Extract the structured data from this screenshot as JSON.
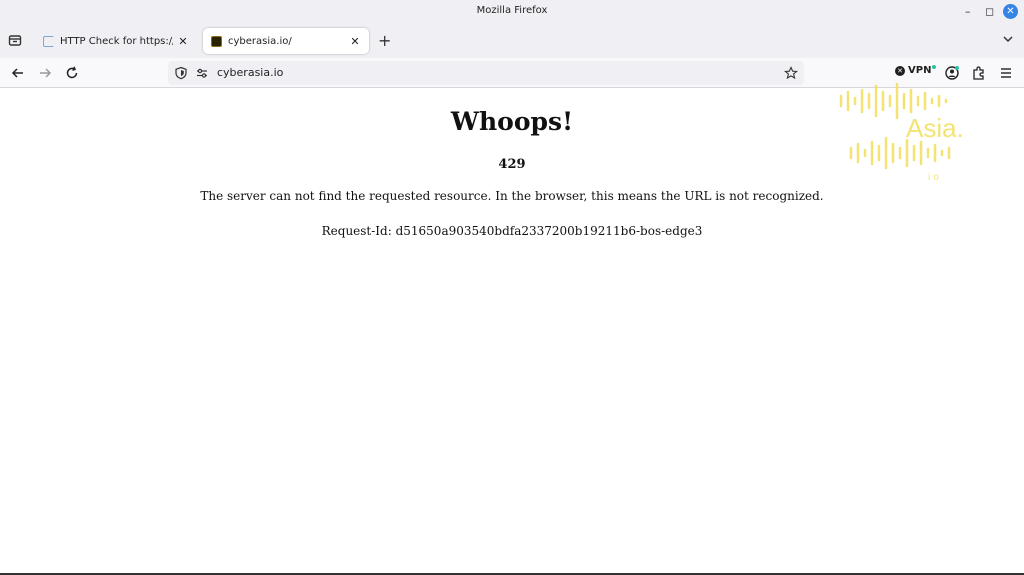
{
  "window": {
    "title": "Mozilla Firefox",
    "controls": {
      "minimize": "–",
      "maximize": "◻",
      "close": "✕"
    }
  },
  "tabs": [
    {
      "label": "HTTP Check for https://cybe",
      "close": "✕",
      "active": false
    },
    {
      "label": "cyberasia.io/",
      "close": "✕",
      "active": true
    }
  ],
  "new_tab": "+",
  "url": "cyberasia.io",
  "vpn_label": "VPN",
  "page": {
    "heading": "Whoops!",
    "code": "429",
    "message": "The server can not find the requested resource. In the browser, this means the URL is not recognized.",
    "request_id": "Request-Id: d51650a903540bdfa2337200b19211b6-bos-edge3"
  },
  "watermark": {
    "word": "Asia.",
    "suffix": "io"
  },
  "colors": {
    "accent": "#3584e4",
    "watermark": "#f3df5a",
    "vpn_badge": "#2ac3a2"
  }
}
